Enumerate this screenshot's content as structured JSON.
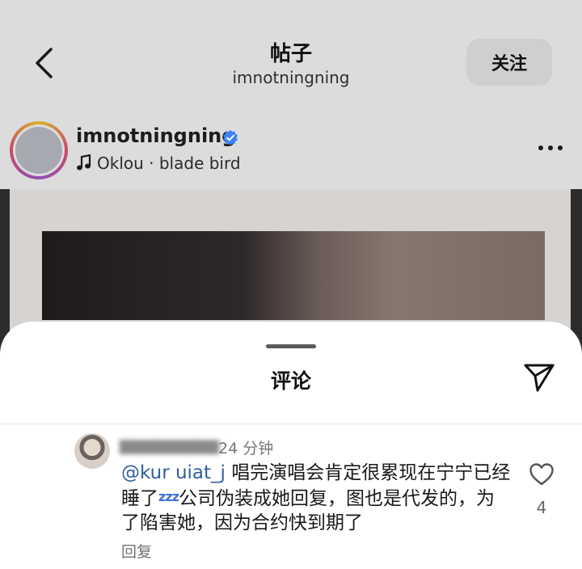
{
  "header": {
    "title": "帖子",
    "subtitle": "imnotningning",
    "follow_label": "关注"
  },
  "post": {
    "username": "imnotningning",
    "verified": true,
    "music": "Oklou · blade bird",
    "icons": [
      "back-arrow-icon",
      "verified-badge-icon",
      "music-note-icon",
      "more-icon"
    ]
  },
  "comments_sheet": {
    "title": "评论",
    "comment": {
      "username": "",
      "time": "24 分钟",
      "mention": "@kur  uiat_j",
      "text_part1": " 唱完演唱会肯定很累现在宁宁已经睡了",
      "zzz": "zzz",
      "text_part2": "公司伪装成她回复，图也是代发的，为了陷害她，因为合约快到期了",
      "reply_label": "回复",
      "likes": "4"
    },
    "icons": [
      "share-send-icon",
      "heart-icon"
    ]
  },
  "colors": {
    "mention": "#2f5fa0",
    "verified": "#3b82f6",
    "zzz": "#3b6fd6"
  }
}
